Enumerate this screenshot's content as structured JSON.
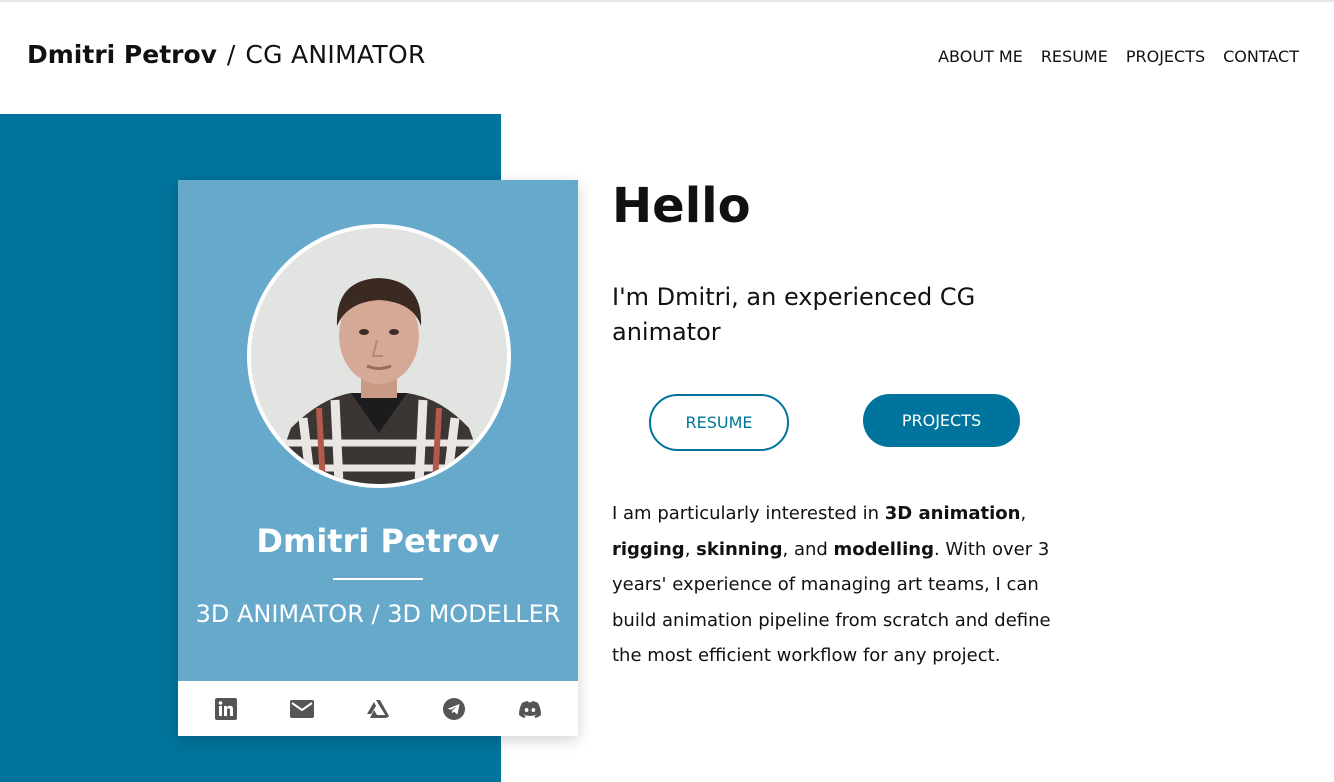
{
  "header": {
    "name": "Dmitri Petrov",
    "separator": "/",
    "role": "CG ANIMATOR",
    "nav": [
      "ABOUT ME",
      "RESUME",
      "PROJECTS",
      "CONTACT"
    ]
  },
  "card": {
    "name": "Dmitri Petrov",
    "role": "3D ANIMATOR / 3D MODELLER",
    "social_icons": [
      "linkedin-icon",
      "email-icon",
      "artstation-icon",
      "telegram-icon",
      "discord-icon"
    ]
  },
  "main": {
    "greeting": "Hello",
    "intro": "I'm Dmitri, an experienced CG animator",
    "resume_button": "RESUME",
    "projects_button": "PROJECTS",
    "bio": {
      "p1": "I am particularly interested in ",
      "b1": "3D animation",
      "p2": ", ",
      "b2": "rigging",
      "p3": ", ",
      "b3": "skinning",
      "p4": ", and ",
      "b4": "modelling",
      "p5": ". With over 3 years' experience of managing art teams, I can build animation pipeline from scratch and define the most efficient workflow for any project."
    }
  },
  "colors": {
    "primary": "#00749c",
    "card": "#66a9cb",
    "text": "#111111"
  }
}
